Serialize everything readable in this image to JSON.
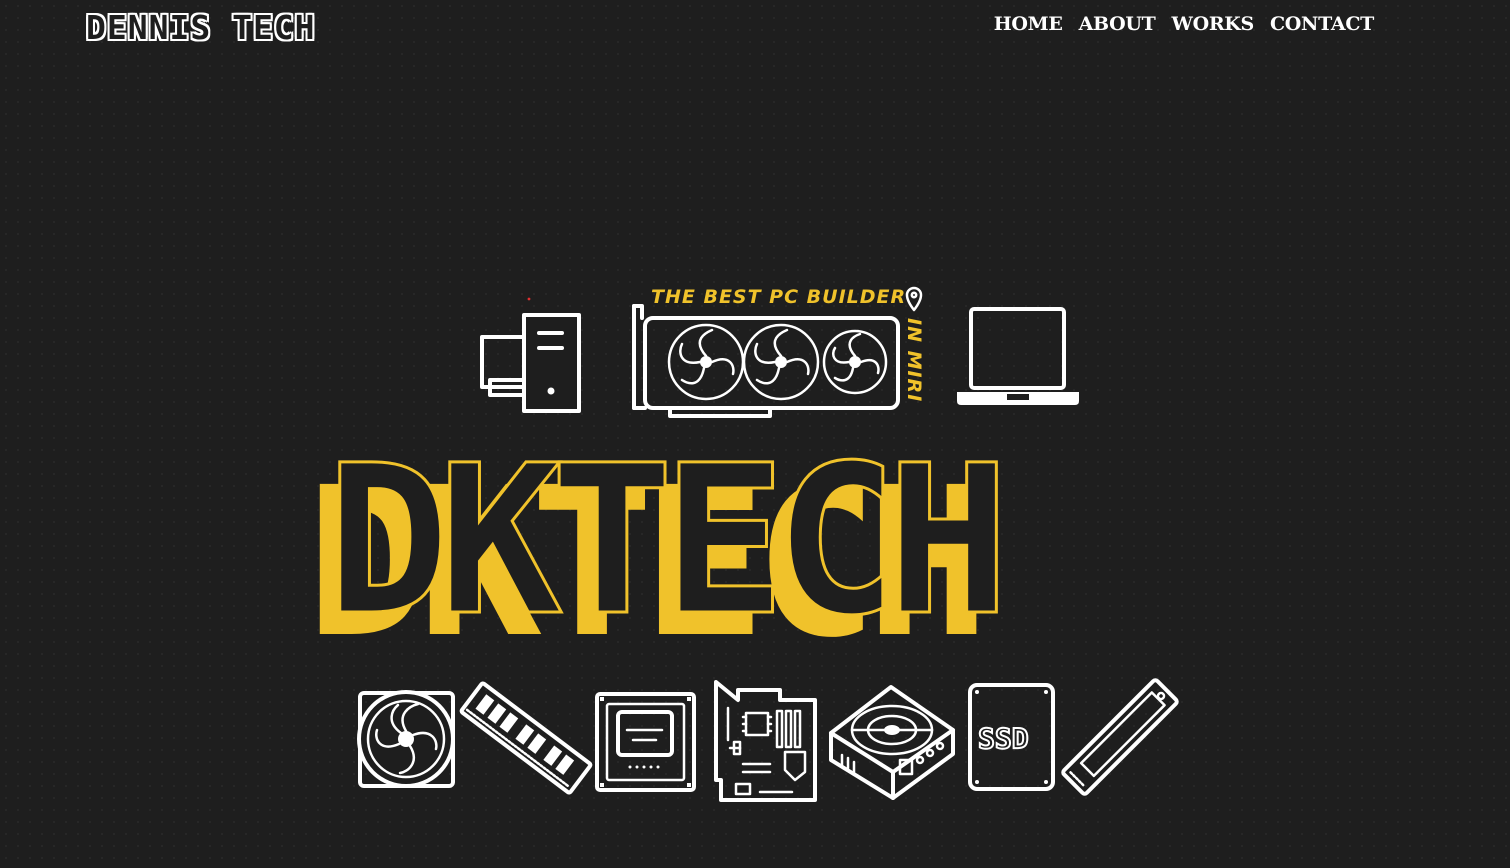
{
  "header": {
    "brand": "DENNIS TECH",
    "nav": [
      {
        "label": "HOME"
      },
      {
        "label": "ABOUT"
      },
      {
        "label": "WORKS"
      },
      {
        "label": "CONTACT"
      }
    ]
  },
  "hero": {
    "tagline": "THE BEST PC BUILDER",
    "location": "IN MIRI",
    "logo": "DKTECH",
    "ssd_label": "SSD",
    "icons": [
      "desktop-pc-icon",
      "graphics-card-icon",
      "laptop-icon",
      "case-fan-icon",
      "ram-stick-icon",
      "cpu-icon",
      "motherboard-icon",
      "power-supply-icon",
      "ssd-icon",
      "m2-ssd-icon"
    ],
    "colors": {
      "accent": "#f0c22b",
      "background": "#1e1e1e",
      "foreground": "#ffffff"
    }
  }
}
